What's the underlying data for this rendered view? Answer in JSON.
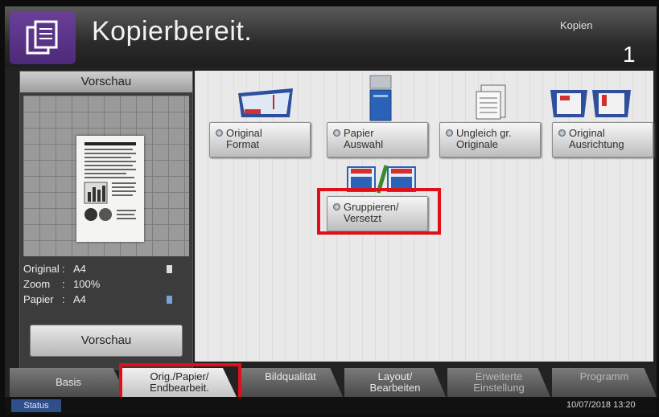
{
  "header": {
    "title": "Kopierbereit.",
    "copies_label": "Kopien",
    "copies_value": "1",
    "app_icon": "copy-icon"
  },
  "preview_panel": {
    "label": "Vorschau",
    "info": [
      {
        "key": "Original",
        "value": "A4"
      },
      {
        "key": "Zoom",
        "value": "100%"
      },
      {
        "key": "Papier",
        "value": "A4"
      }
    ],
    "button_label": "Vorschau"
  },
  "functions": {
    "original_format": "Original\nFormat",
    "papier_auswahl": "Papier\nAuswahl",
    "ungleich": "Ungleich gr.\nOriginale",
    "ausrichtung": "Original\nAusrichtung",
    "gruppieren": "Gruppieren/\nVersetzt"
  },
  "tabs": [
    {
      "label": "Basis"
    },
    {
      "label": "Orig./Papier/\nEndbearbeit."
    },
    {
      "label": "Bildqualität"
    },
    {
      "label": "Layout/\nBearbeiten"
    },
    {
      "label": "Erweiterte\nEinstellung"
    },
    {
      "label": "Programm"
    }
  ],
  "status_bar": {
    "status_label": "Status",
    "datetime": "10/07/2018 13:20"
  },
  "colors": {
    "highlight": "#e0101a",
    "app_icon_bg": "#5a3488",
    "status_button": "#2f4e8a"
  }
}
